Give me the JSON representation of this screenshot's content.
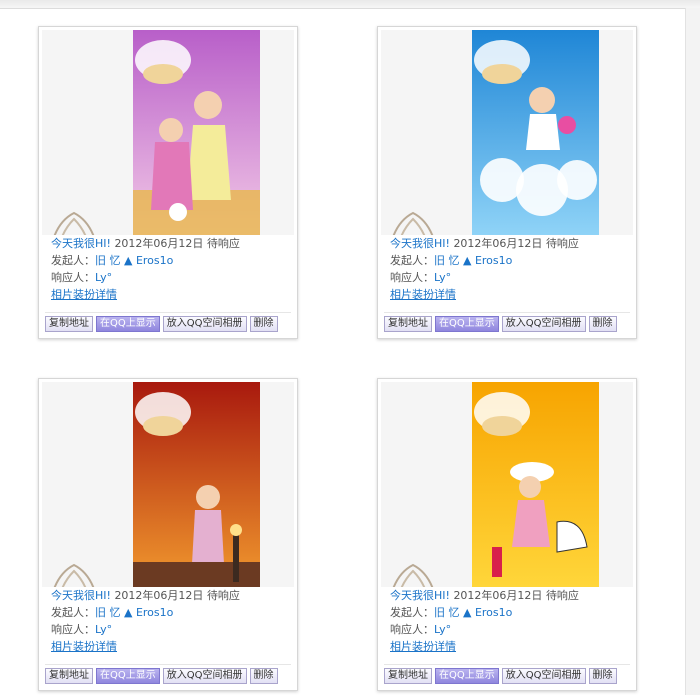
{
  "cards": [
    {
      "title": "今天我很HI!",
      "date": "2012年06月12日",
      "status": "待响应",
      "initiator_label": "发起人：",
      "initiator_name": "旧 忆 ▲ Eros1o",
      "responder_label": "响应人：",
      "responder_name": "Ly°",
      "detail_link": "相片装扮详情",
      "photo_theme": {
        "top": "#b85fc9",
        "bottom": "#f2c8e6",
        "accent": "#f7c24a"
      }
    },
    {
      "title": "今天我很HI!",
      "date": "2012年06月12日",
      "status": "待响应",
      "initiator_label": "发起人：",
      "initiator_name": "旧 忆 ▲ Eros1o",
      "responder_label": "响应人：",
      "responder_name": "Ly°",
      "detail_link": "相片装扮详情",
      "photo_theme": {
        "top": "#1f86d6",
        "bottom": "#8fd3f7",
        "accent": "#ffffff"
      }
    },
    {
      "title": "今天我很HI!",
      "date": "2012年06月12日",
      "status": "待响应",
      "initiator_label": "发起人：",
      "initiator_name": "旧 忆 ▲ Eros1o",
      "responder_label": "响应人：",
      "responder_name": "Ly°",
      "detail_link": "相片装扮详情",
      "photo_theme": {
        "top": "#a8190e",
        "bottom": "#f29a2e",
        "accent": "#5a3522"
      }
    },
    {
      "title": "今天我很HI!",
      "date": "2012年06月12日",
      "status": "待响应",
      "initiator_label": "发起人：",
      "initiator_name": "旧 忆 ▲ Eros1o",
      "responder_label": "响应人：",
      "responder_name": "Ly°",
      "detail_link": "相片装扮详情",
      "photo_theme": {
        "top": "#f7a400",
        "bottom": "#ffd63a",
        "accent": "#d81f4b"
      }
    }
  ],
  "buttons": {
    "copy": "复制地址",
    "show_on_qq": "在QQ上显示",
    "add_to_album": "放入QQ空间相册",
    "delete": "删除"
  },
  "icons": {
    "card_corner": "feather-deco-icon",
    "photo_top": "milk-splash-icon"
  }
}
